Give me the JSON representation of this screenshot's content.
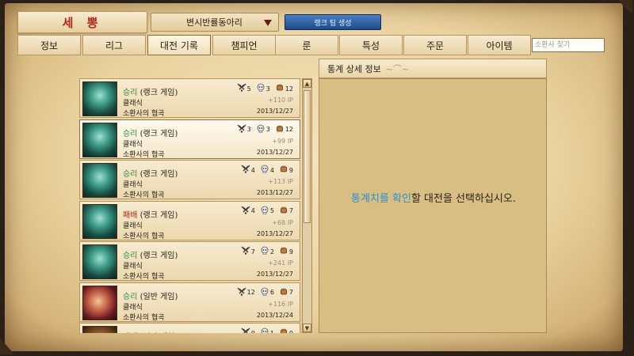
{
  "header": {
    "summoner_name": "세 뽕",
    "club_dropdown": "변시반률동아리",
    "rank_team_button": "랭크 팀 생성"
  },
  "tabs": [
    {
      "label": "정보"
    },
    {
      "label": "리그"
    },
    {
      "label": "대전 기록",
      "active": true
    },
    {
      "label": "챔피언"
    },
    {
      "label": "룬"
    },
    {
      "label": "특성"
    },
    {
      "label": "주문"
    },
    {
      "label": "아이템"
    }
  ],
  "search": {
    "placeholder": "소환사 찾기",
    "value": ""
  },
  "matches": [
    {
      "result": "승리",
      "queue": "(랭크 게임)",
      "mode": "클래식",
      "map": "소환사의 협곡",
      "kills": "5",
      "deaths": "3",
      "assists": "12",
      "ip": "+110 IP",
      "date": "2013/12/27",
      "champion_icon": "thresh"
    },
    {
      "result": "승리",
      "queue": "(랭크 게임)",
      "mode": "클래식",
      "map": "소환사의 협곡",
      "kills": "3",
      "deaths": "3",
      "assists": "12",
      "ip": "+99 IP",
      "date": "2013/12/27",
      "champion_icon": "thresh",
      "selected": true
    },
    {
      "result": "승리",
      "queue": "(랭크 게임)",
      "mode": "클래식",
      "map": "소환사의 협곡",
      "kills": "4",
      "deaths": "4",
      "assists": "9",
      "ip": "+113 IP",
      "date": "2013/12/27",
      "champion_icon": "thresh"
    },
    {
      "result": "패배",
      "queue": "(랭크 게임)",
      "mode": "클래식",
      "map": "소환사의 협곡",
      "kills": "4",
      "deaths": "5",
      "assists": "7",
      "ip": "+68 IP",
      "date": "2013/12/27",
      "champion_icon": "thresh"
    },
    {
      "result": "승리",
      "queue": "(랭크 게임)",
      "mode": "클래식",
      "map": "소환사의 협곡",
      "kills": "7",
      "deaths": "2",
      "assists": "9",
      "ip": "+241 IP",
      "date": "2013/12/27",
      "champion_icon": "thresh"
    },
    {
      "result": "승리",
      "queue": "(일반 게임)",
      "mode": "클래식",
      "map": "소환사의 협곡",
      "kills": "12",
      "deaths": "6",
      "assists": "7",
      "ip": "+116 IP",
      "date": "2013/12/24",
      "champion_icon": "katarina"
    },
    {
      "result": "패배",
      "queue": "(일반 게임)",
      "mode": "",
      "map": "",
      "kills": "0",
      "deaths": "1",
      "assists": "0",
      "ip": "",
      "date": "",
      "champion_icon": "other"
    }
  ],
  "detail": {
    "header": "통계 상세 정보",
    "message_highlight": "통계치를 확인",
    "message_rest": "할 대전을 선택하십시오."
  },
  "colors": {
    "win": "#2a8a3a",
    "loss": "#b0261a",
    "accent_blue": "#2f8fd0",
    "summoner_name": "#b02a1a"
  }
}
